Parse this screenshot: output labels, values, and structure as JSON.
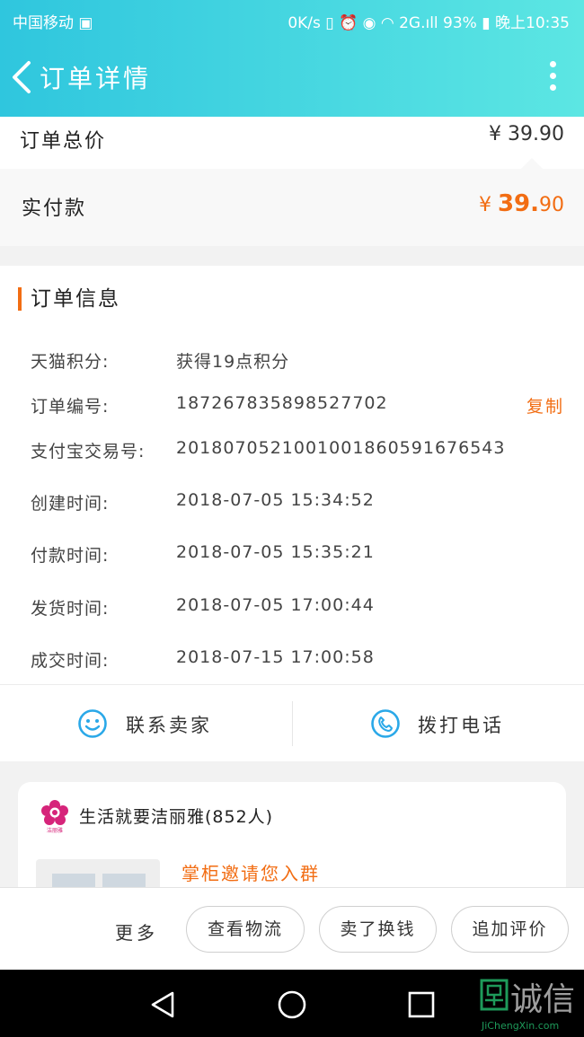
{
  "status_bar": {
    "left": "中国移动 ▣",
    "right": "0K/s ▯ ⏰ ◉ ◠ 2G.ıll 93% ▮ 晚上10:35"
  },
  "header": {
    "title": "订单详情"
  },
  "price": {
    "total_label": "订单总价",
    "total_value": "¥ 39.90",
    "paid_label": "实付款",
    "paid_currency": "¥ ",
    "paid_int": "39.",
    "paid_dec": "90"
  },
  "order_info": {
    "title": "订单信息",
    "rows": [
      {
        "key": "天猫积分:",
        "value": "获得19点积分"
      },
      {
        "key": "订单编号:",
        "value": "187267835898527702",
        "action": "复制"
      },
      {
        "key": "支付宝交易号:",
        "value": "2018070521001001860591676543"
      },
      {
        "key": "创建时间:",
        "value": "2018-07-05 15:34:52"
      },
      {
        "key": "付款时间:",
        "value": "2018-07-05 15:35:21"
      },
      {
        "key": "发货时间:",
        "value": "2018-07-05 17:00:44"
      },
      {
        "key": "成交时间:",
        "value": "2018-07-15 17:00:58"
      }
    ]
  },
  "actions": {
    "contact_seller": "联系卖家",
    "call_phone": "拨打电话"
  },
  "group": {
    "name": "生活就要洁丽雅(852人)",
    "invite": "掌柜邀请您入群",
    "logo_caption": "洁丽雅"
  },
  "bottom_bar": {
    "more": "更多",
    "buttons": [
      "查看物流",
      "卖了换钱",
      "追加评价"
    ]
  },
  "watermark": {
    "text": "诚信",
    "sub": "JiChengXin.com"
  },
  "colors": {
    "accent": "#f26d13",
    "header_start": "#2fc6de",
    "header_end": "#5ce6e3",
    "icon_blue": "#2aa8e8"
  }
}
